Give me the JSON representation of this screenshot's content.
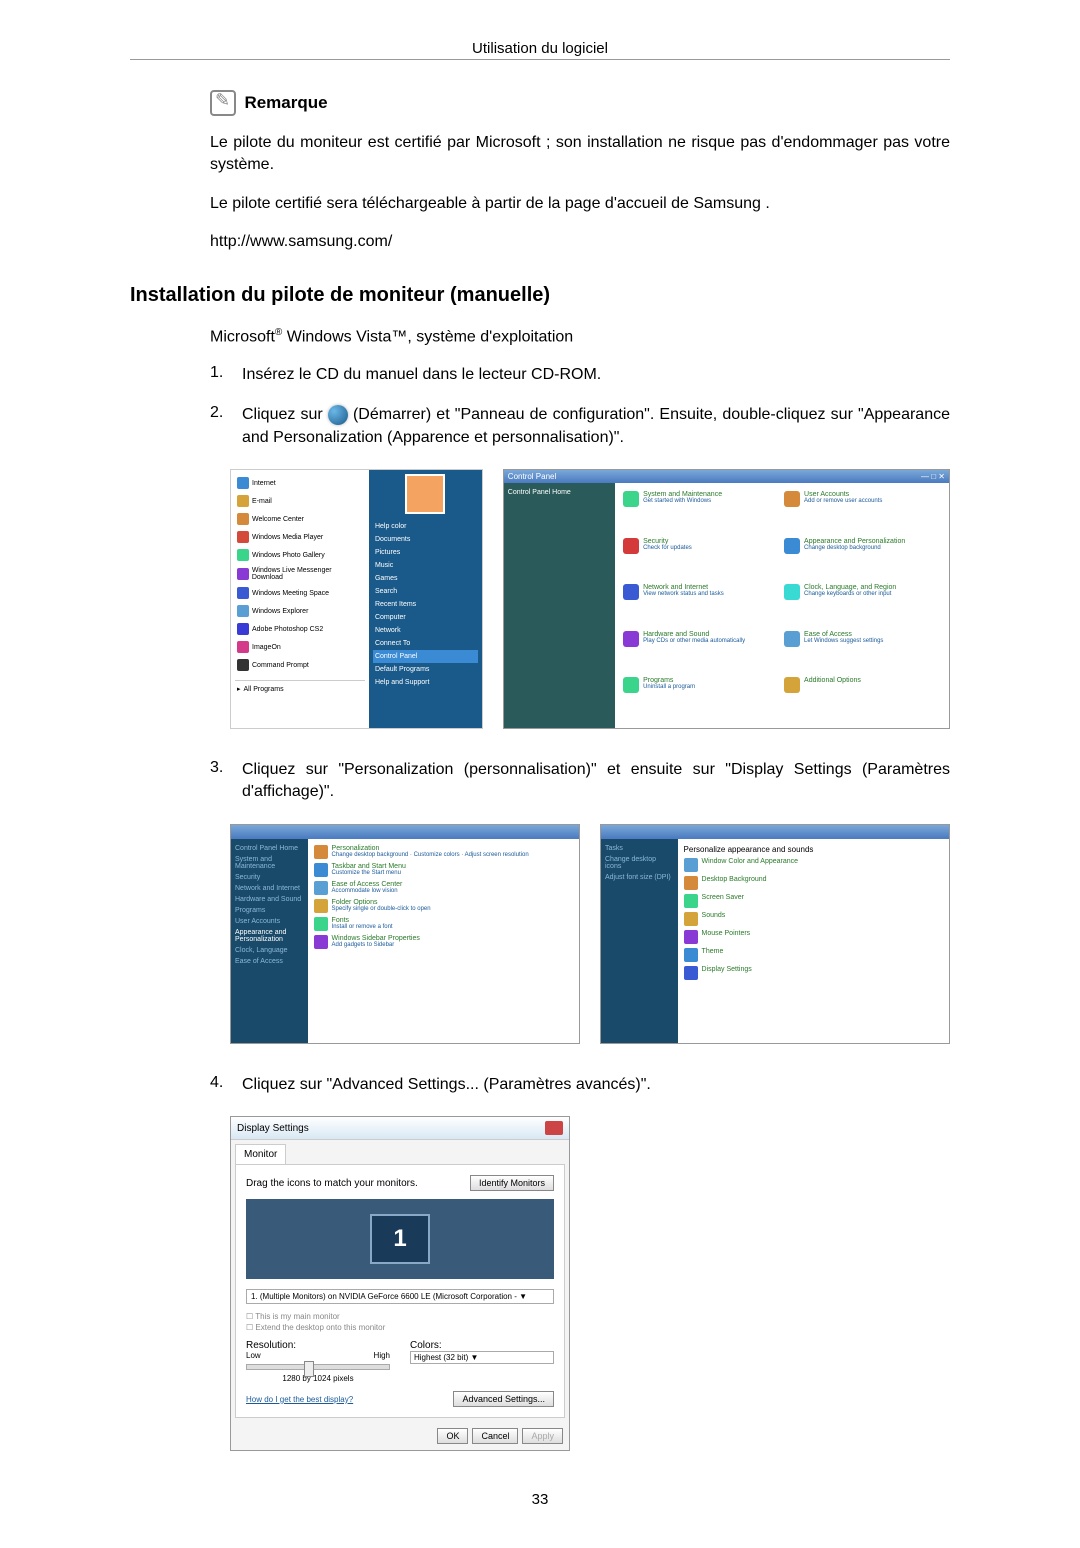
{
  "header": "Utilisation du logiciel",
  "remark": {
    "title": "Remarque",
    "p1": "Le pilote du moniteur est certifié par Microsoft ; son installation ne risque pas d'endommager pas votre système.",
    "p2": "Le pilote certifié sera téléchargeable à partir de la page d'accueil de Samsung .",
    "p3": "http://www.samsung.com/"
  },
  "section_heading": "Installation du pilote de moniteur (manuelle)",
  "os_line_pre": "Microsoft",
  "os_line_mid": " Windows Vista",
  "os_line_post": ", système d'exploitation",
  "reg_mark": "®",
  "tm_mark": "™",
  "steps": {
    "s1_num": "1.",
    "s1_text": "Insérez le CD du manuel dans le lecteur CD-ROM.",
    "s2_num": "2.",
    "s2_pre": "Cliquez sur",
    "s2_post": "(Démarrer) et \"Panneau de configuration\". Ensuite, double-cliquez sur \"Appearance and Personalization (Apparence et personnalisation)\".",
    "s3_num": "3.",
    "s3_text": "Cliquez sur \"Personalization (personnalisation)\" et ensuite sur \"Display Settings (Paramètres d'affichage)\".",
    "s4_num": "4.",
    "s4_text": "Cliquez sur \"Advanced Settings... (Paramètres avancés)\"."
  },
  "start_menu": {
    "items": [
      "Internet",
      "E-mail",
      "Welcome Center",
      "Windows Media Player",
      "Windows Photo Gallery",
      "Windows Live Messenger Download",
      "Windows Meeting Space",
      "Windows Explorer",
      "Adobe Photoshop CS2",
      "ImageOn",
      "Command Prompt"
    ],
    "all_programs": "All Programs",
    "right_items": [
      "Help color",
      "Documents",
      "Pictures",
      "Music",
      "Games",
      "Search",
      "Recent Items",
      "Computer",
      "Network",
      "Connect To",
      "Control Panel",
      "Default Programs",
      "Help and Support"
    ]
  },
  "control_panel": {
    "title": "Control Panel",
    "sidebar": "Control Panel Home",
    "cats": [
      {
        "h": "System and Maintenance",
        "s": "Get started with Windows"
      },
      {
        "h": "User Accounts",
        "s": "Add or remove user accounts"
      },
      {
        "h": "Security",
        "s": "Check for updates"
      },
      {
        "h": "Appearance and Personalization",
        "s": "Change desktop background"
      },
      {
        "h": "Network and Internet",
        "s": "View network status and tasks"
      },
      {
        "h": "Clock, Language, and Region",
        "s": "Change keyboards or other input"
      },
      {
        "h": "Hardware and Sound",
        "s": "Play CDs or other media automatically"
      },
      {
        "h": "Ease of Access",
        "s": "Let Windows suggest settings"
      },
      {
        "h": "Programs",
        "s": "Uninstall a program"
      },
      {
        "h": "Additional Options",
        "s": ""
      }
    ]
  },
  "appearance_panel": {
    "side": [
      "Control Panel Home",
      "System and Maintenance",
      "Security",
      "Network and Internet",
      "Hardware and Sound",
      "Programs",
      "User Accounts",
      "Appearance and Personalization",
      "Clock, Language",
      "Ease of Access"
    ],
    "cats": [
      {
        "h": "Personalization",
        "s": "Change desktop background · Customize colors · Adjust screen resolution"
      },
      {
        "h": "Taskbar and Start Menu",
        "s": "Customize the Start menu"
      },
      {
        "h": "Ease of Access Center",
        "s": "Accommodate low vision"
      },
      {
        "h": "Folder Options",
        "s": "Specify single or double-click to open"
      },
      {
        "h": "Fonts",
        "s": "Install or remove a font"
      },
      {
        "h": "Windows Sidebar Properties",
        "s": "Add gadgets to Sidebar"
      }
    ]
  },
  "personalization_panel": {
    "title": "Personalize appearance and sounds",
    "items": [
      "Window Color and Appearance",
      "Desktop Background",
      "Screen Saver",
      "Sounds",
      "Mouse Pointers",
      "Theme",
      "Display Settings"
    ]
  },
  "display_settings": {
    "title": "Display Settings",
    "tab": "Monitor",
    "drag_text": "Drag the icons to match your monitors.",
    "identify_btn": "Identify Monitors",
    "monitor_num": "1",
    "dropdown": "1. (Multiple Monitors) on NVIDIA GeForce 6600 LE (Microsoft Corporation - ▼",
    "check1": "☐ This is my main monitor",
    "check2": "☐ Extend the desktop onto this monitor",
    "resolution_label": "Resolution:",
    "res_low": "Low",
    "res_high": "High",
    "res_value": "1280 by 1024 pixels",
    "colors_label": "Colors:",
    "colors_value": "Highest (32 bit)    ▼",
    "help_link": "How do I get the best display?",
    "advanced_btn": "Advanced Settings...",
    "ok": "OK",
    "cancel": "Cancel",
    "apply": "Apply"
  },
  "page_number": "33"
}
